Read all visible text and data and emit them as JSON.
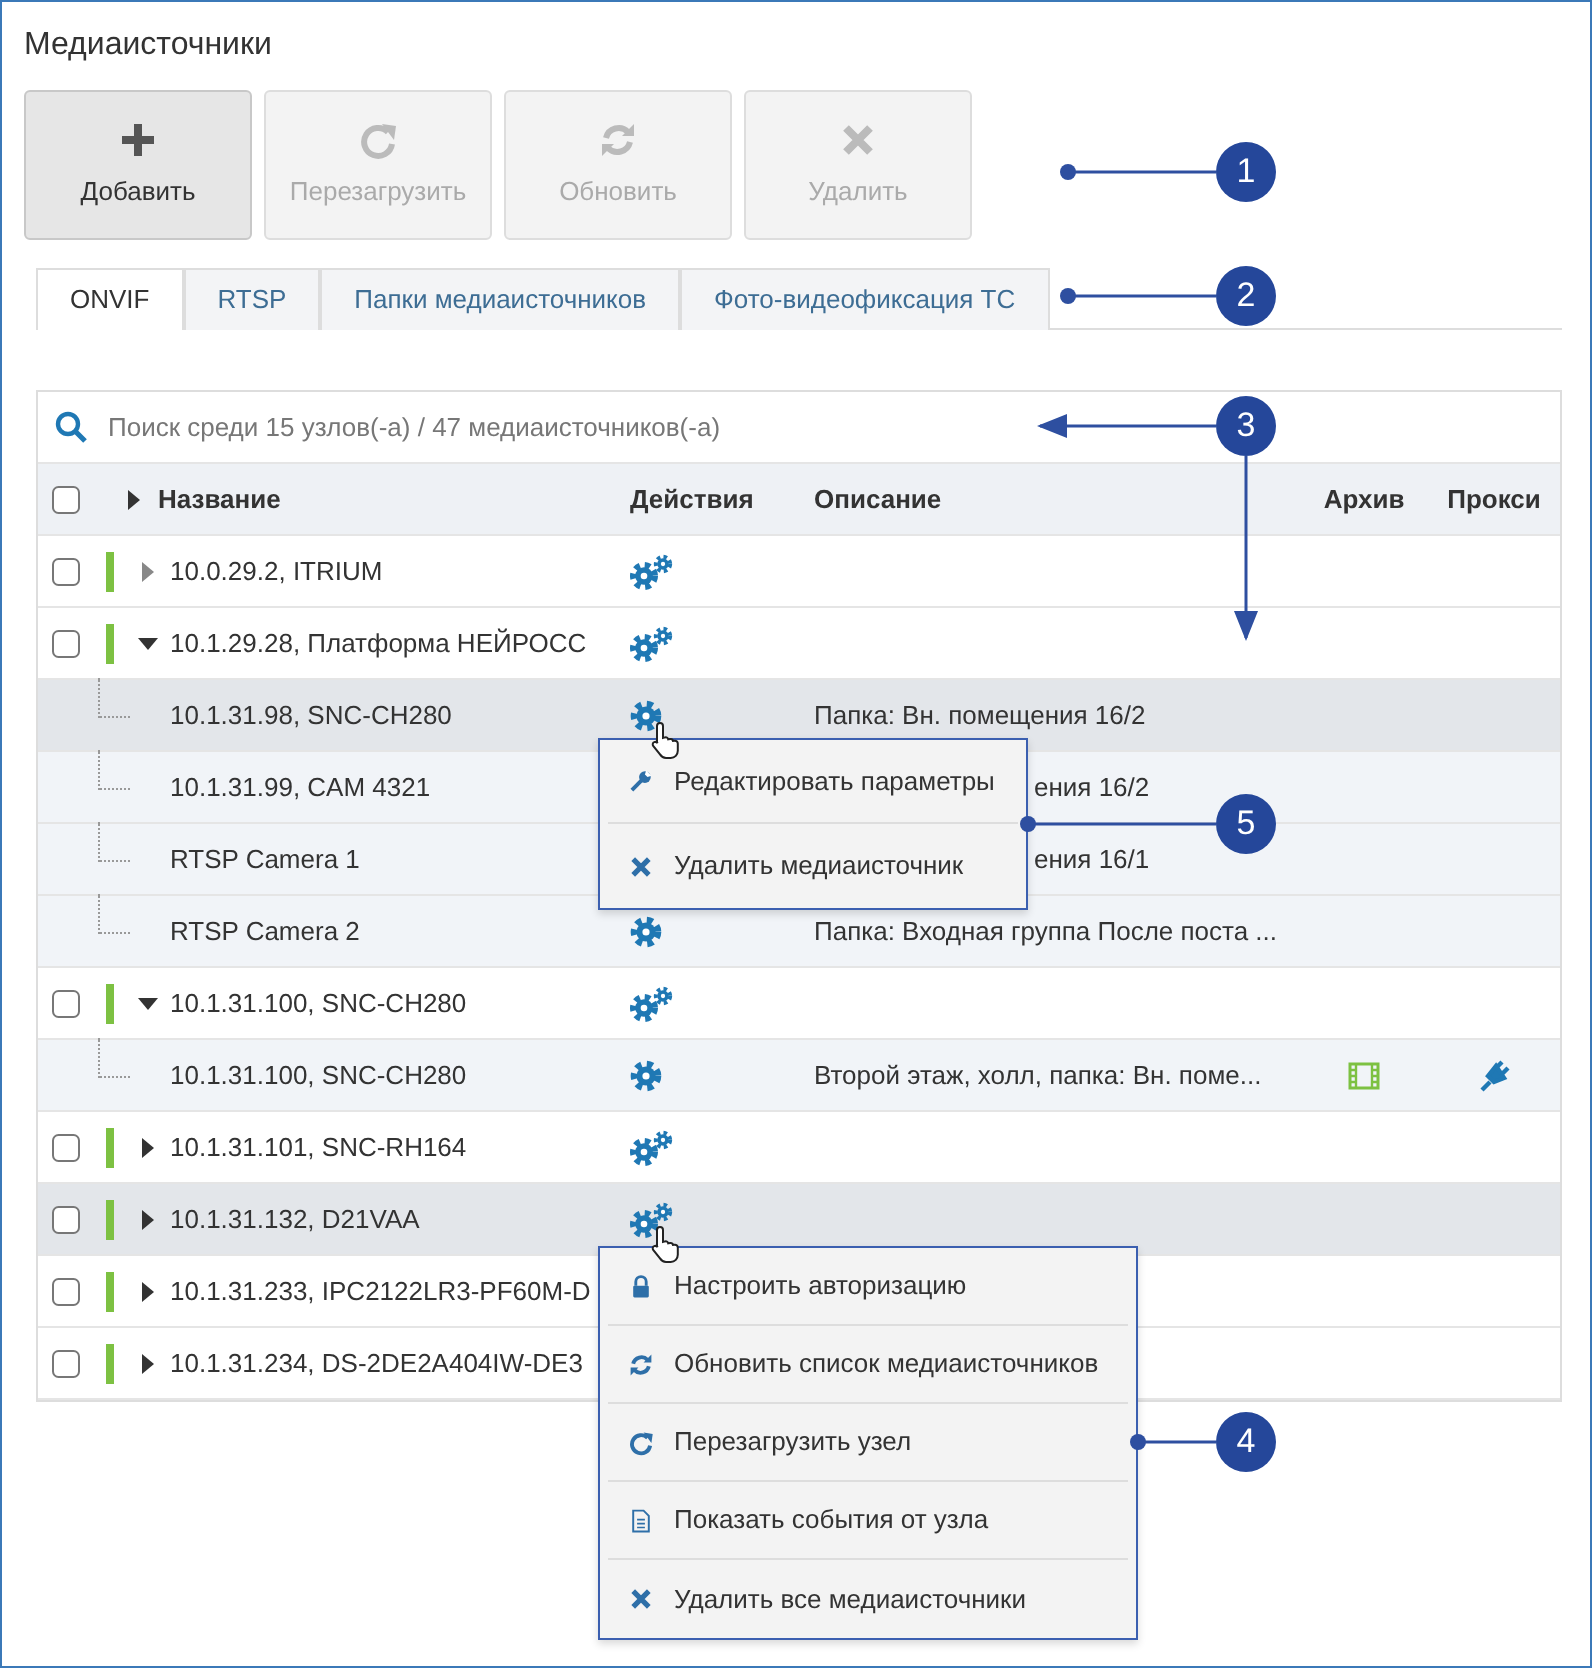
{
  "title": "Медиаисточники",
  "toolbar": [
    {
      "kind": "plus",
      "label": "Добавить",
      "disabled": false
    },
    {
      "kind": "reload",
      "label": "Перезагрузить",
      "disabled": true
    },
    {
      "kind": "refresh",
      "label": "Обновить",
      "disabled": true
    },
    {
      "kind": "delete",
      "label": "Удалить",
      "disabled": true
    }
  ],
  "tabs": [
    {
      "label": "ONVIF",
      "selected": true
    },
    {
      "label": "RTSP",
      "selected": false
    },
    {
      "label": "Папки медиаисточников",
      "selected": false
    },
    {
      "label": "Фото-видеофиксация ТС",
      "selected": false
    }
  ],
  "search": {
    "placeholder": "Поиск среди 15 узлов(-а) / 47 медиаисточников(-а)"
  },
  "table": {
    "header_checked": false,
    "columns": [
      "Название",
      "Действия",
      "Описание",
      "Архив",
      "Прокси"
    ],
    "rows": [
      {
        "name": "10.0.29.2, ITRIUM",
        "checked": false,
        "online": true,
        "has_children": false,
        "expanded": false,
        "highlighted": false,
        "children": []
      },
      {
        "name": "10.1.29.28, Платформа НЕЙРОСС",
        "checked": false,
        "online": true,
        "has_children": true,
        "expanded": true,
        "highlighted": false,
        "children": [
          {
            "name": "10.1.31.98, SNC-CH280",
            "actions": true,
            "description": "Папка: Вн. помещения 16/2",
            "covered": false,
            "archive": false,
            "proxy": false,
            "highlighted": true
          },
          {
            "name": "10.1.31.99, CAM 4321",
            "actions": false,
            "description": "ения 16/2",
            "covered": true,
            "archive": false,
            "proxy": false,
            "highlighted": false
          },
          {
            "name": "RTSP Camera 1",
            "actions": false,
            "description": "ения 16/1",
            "covered": true,
            "archive": false,
            "proxy": false,
            "highlighted": false
          },
          {
            "name": "RTSP Camera 2",
            "actions": true,
            "description": "Папка: Входная группа После поста ...",
            "covered": false,
            "archive": false,
            "proxy": false,
            "highlighted": false
          }
        ]
      },
      {
        "name": "10.1.31.100, SNC-CH280",
        "checked": false,
        "online": true,
        "has_children": true,
        "expanded": true,
        "highlighted": false,
        "children": [
          {
            "name": "10.1.31.100, SNC-CH280",
            "actions": true,
            "description": "Второй этаж, холл, папка: Вн. поме...",
            "covered": false,
            "archive": true,
            "proxy": true,
            "highlighted": false
          }
        ]
      },
      {
        "name": "10.1.31.101, SNC-RH164",
        "checked": false,
        "online": true,
        "has_children": true,
        "expanded": false,
        "highlighted": false,
        "children": []
      },
      {
        "name": "10.1.31.132, D21VAA",
        "checked": false,
        "online": true,
        "has_children": true,
        "expanded": false,
        "highlighted": true,
        "children": []
      },
      {
        "name": "10.1.31.233, IPC2122LR3-PF60M-D",
        "actions": false,
        "checked": false,
        "online": true,
        "has_children": true,
        "expanded": false,
        "highlighted": false,
        "children": []
      },
      {
        "name": "10.1.31.234, DS-2DE2A404IW-DE3",
        "actions": false,
        "checked": false,
        "online": true,
        "has_children": true,
        "expanded": false,
        "highlighted": false,
        "children": []
      }
    ]
  },
  "menus": [
    {
      "items": [
        {
          "kind": "wrench",
          "label": "Редактировать параметры"
        },
        {
          "kind": "delete",
          "label": "Удалить медиаисточник"
        }
      ]
    },
    {
      "items": [
        {
          "kind": "lock",
          "label": "Настроить авторизацию"
        },
        {
          "kind": "refresh",
          "label": "Обновить список медиаисточников"
        },
        {
          "kind": "reload",
          "label": "Перезагрузить узел"
        },
        {
          "kind": "document",
          "label": "Показать события от узла"
        },
        {
          "kind": "delete",
          "label": "Удалить все медиаисточники"
        }
      ]
    }
  ],
  "callouts": [
    "1",
    "2",
    "3",
    "5",
    "4"
  ]
}
